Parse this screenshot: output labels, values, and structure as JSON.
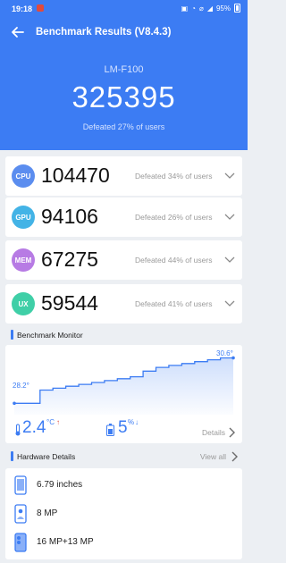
{
  "status_bar": {
    "time": "19:18",
    "icons": [
      "nfc-icon",
      "wifi-icon",
      "mute-icon",
      "signal-icon"
    ],
    "battery": "95%"
  },
  "header": {
    "title": "Benchmark Results (V8.4.3)",
    "device": "LM-F100",
    "total_score": "325395",
    "defeated": "Defeated 27% of users"
  },
  "scores": [
    {
      "badge": "CPU",
      "value": "104470",
      "defeated": "Defeated 34% of users",
      "color": "#5b8def"
    },
    {
      "badge": "GPU",
      "value": "94106",
      "defeated": "Defeated 26% of users",
      "color": "#43b3e6"
    },
    {
      "badge": "MEM",
      "value": "67275",
      "defeated": "Defeated 44% of users",
      "color": "#b77be4"
    },
    {
      "badge": "UX",
      "value": "59544",
      "defeated": "Defeated 41% of users",
      "color": "#3fcfa7"
    }
  ],
  "monitor": {
    "title": "Benchmark Monitor",
    "temp_start": "28.2°",
    "temp_end": "30.6°",
    "temp_rise": "2.4",
    "temp_unit": "°C",
    "temp_arrow": "↑",
    "battery_drop": "5",
    "battery_unit": "%",
    "battery_arrow": "↓",
    "details": "Details"
  },
  "chart_data": {
    "type": "line",
    "series": [
      {
        "values": [
          28.2,
          28.2,
          28.9,
          29.0,
          29.1,
          29.2,
          29.3,
          29.4,
          29.5,
          29.6,
          29.9,
          30.1,
          30.2,
          30.3,
          30.4,
          30.5,
          30.6,
          30.6
        ]
      }
    ],
    "ylim": [
      27.6,
      31.0
    ]
  },
  "hardware": {
    "title": "Hardware Details",
    "view_all": "View all",
    "items": [
      {
        "icon": "screen-size-icon",
        "text": "6.79 inches"
      },
      {
        "icon": "front-camera-icon",
        "text": "8 MP"
      },
      {
        "icon": "rear-camera-icon",
        "text": "16 MP+13 MP"
      }
    ]
  },
  "colors": {
    "accent": "#3c7cf3",
    "background": "#eceff3"
  }
}
